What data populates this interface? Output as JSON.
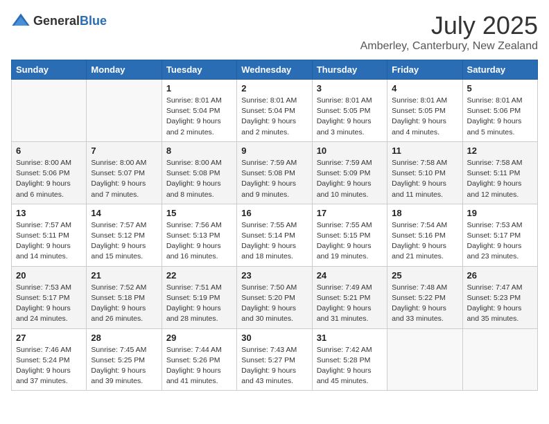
{
  "header": {
    "logo_general": "General",
    "logo_blue": "Blue",
    "month": "July 2025",
    "location": "Amberley, Canterbury, New Zealand"
  },
  "weekdays": [
    "Sunday",
    "Monday",
    "Tuesday",
    "Wednesday",
    "Thursday",
    "Friday",
    "Saturday"
  ],
  "weeks": [
    [
      {
        "day": "",
        "empty": true
      },
      {
        "day": "",
        "empty": true
      },
      {
        "day": "1",
        "sunrise": "Sunrise: 8:01 AM",
        "sunset": "Sunset: 5:04 PM",
        "daylight": "Daylight: 9 hours and 2 minutes."
      },
      {
        "day": "2",
        "sunrise": "Sunrise: 8:01 AM",
        "sunset": "Sunset: 5:04 PM",
        "daylight": "Daylight: 9 hours and 2 minutes."
      },
      {
        "day": "3",
        "sunrise": "Sunrise: 8:01 AM",
        "sunset": "Sunset: 5:05 PM",
        "daylight": "Daylight: 9 hours and 3 minutes."
      },
      {
        "day": "4",
        "sunrise": "Sunrise: 8:01 AM",
        "sunset": "Sunset: 5:05 PM",
        "daylight": "Daylight: 9 hours and 4 minutes."
      },
      {
        "day": "5",
        "sunrise": "Sunrise: 8:01 AM",
        "sunset": "Sunset: 5:06 PM",
        "daylight": "Daylight: 9 hours and 5 minutes."
      }
    ],
    [
      {
        "day": "6",
        "sunrise": "Sunrise: 8:00 AM",
        "sunset": "Sunset: 5:06 PM",
        "daylight": "Daylight: 9 hours and 6 minutes."
      },
      {
        "day": "7",
        "sunrise": "Sunrise: 8:00 AM",
        "sunset": "Sunset: 5:07 PM",
        "daylight": "Daylight: 9 hours and 7 minutes."
      },
      {
        "day": "8",
        "sunrise": "Sunrise: 8:00 AM",
        "sunset": "Sunset: 5:08 PM",
        "daylight": "Daylight: 9 hours and 8 minutes."
      },
      {
        "day": "9",
        "sunrise": "Sunrise: 7:59 AM",
        "sunset": "Sunset: 5:08 PM",
        "daylight": "Daylight: 9 hours and 9 minutes."
      },
      {
        "day": "10",
        "sunrise": "Sunrise: 7:59 AM",
        "sunset": "Sunset: 5:09 PM",
        "daylight": "Daylight: 9 hours and 10 minutes."
      },
      {
        "day": "11",
        "sunrise": "Sunrise: 7:58 AM",
        "sunset": "Sunset: 5:10 PM",
        "daylight": "Daylight: 9 hours and 11 minutes."
      },
      {
        "day": "12",
        "sunrise": "Sunrise: 7:58 AM",
        "sunset": "Sunset: 5:11 PM",
        "daylight": "Daylight: 9 hours and 12 minutes."
      }
    ],
    [
      {
        "day": "13",
        "sunrise": "Sunrise: 7:57 AM",
        "sunset": "Sunset: 5:11 PM",
        "daylight": "Daylight: 9 hours and 14 minutes."
      },
      {
        "day": "14",
        "sunrise": "Sunrise: 7:57 AM",
        "sunset": "Sunset: 5:12 PM",
        "daylight": "Daylight: 9 hours and 15 minutes."
      },
      {
        "day": "15",
        "sunrise": "Sunrise: 7:56 AM",
        "sunset": "Sunset: 5:13 PM",
        "daylight": "Daylight: 9 hours and 16 minutes."
      },
      {
        "day": "16",
        "sunrise": "Sunrise: 7:55 AM",
        "sunset": "Sunset: 5:14 PM",
        "daylight": "Daylight: 9 hours and 18 minutes."
      },
      {
        "day": "17",
        "sunrise": "Sunrise: 7:55 AM",
        "sunset": "Sunset: 5:15 PM",
        "daylight": "Daylight: 9 hours and 19 minutes."
      },
      {
        "day": "18",
        "sunrise": "Sunrise: 7:54 AM",
        "sunset": "Sunset: 5:16 PM",
        "daylight": "Daylight: 9 hours and 21 minutes."
      },
      {
        "day": "19",
        "sunrise": "Sunrise: 7:53 AM",
        "sunset": "Sunset: 5:17 PM",
        "daylight": "Daylight: 9 hours and 23 minutes."
      }
    ],
    [
      {
        "day": "20",
        "sunrise": "Sunrise: 7:53 AM",
        "sunset": "Sunset: 5:17 PM",
        "daylight": "Daylight: 9 hours and 24 minutes."
      },
      {
        "day": "21",
        "sunrise": "Sunrise: 7:52 AM",
        "sunset": "Sunset: 5:18 PM",
        "daylight": "Daylight: 9 hours and 26 minutes."
      },
      {
        "day": "22",
        "sunrise": "Sunrise: 7:51 AM",
        "sunset": "Sunset: 5:19 PM",
        "daylight": "Daylight: 9 hours and 28 minutes."
      },
      {
        "day": "23",
        "sunrise": "Sunrise: 7:50 AM",
        "sunset": "Sunset: 5:20 PM",
        "daylight": "Daylight: 9 hours and 30 minutes."
      },
      {
        "day": "24",
        "sunrise": "Sunrise: 7:49 AM",
        "sunset": "Sunset: 5:21 PM",
        "daylight": "Daylight: 9 hours and 31 minutes."
      },
      {
        "day": "25",
        "sunrise": "Sunrise: 7:48 AM",
        "sunset": "Sunset: 5:22 PM",
        "daylight": "Daylight: 9 hours and 33 minutes."
      },
      {
        "day": "26",
        "sunrise": "Sunrise: 7:47 AM",
        "sunset": "Sunset: 5:23 PM",
        "daylight": "Daylight: 9 hours and 35 minutes."
      }
    ],
    [
      {
        "day": "27",
        "sunrise": "Sunrise: 7:46 AM",
        "sunset": "Sunset: 5:24 PM",
        "daylight": "Daylight: 9 hours and 37 minutes."
      },
      {
        "day": "28",
        "sunrise": "Sunrise: 7:45 AM",
        "sunset": "Sunset: 5:25 PM",
        "daylight": "Daylight: 9 hours and 39 minutes."
      },
      {
        "day": "29",
        "sunrise": "Sunrise: 7:44 AM",
        "sunset": "Sunset: 5:26 PM",
        "daylight": "Daylight: 9 hours and 41 minutes."
      },
      {
        "day": "30",
        "sunrise": "Sunrise: 7:43 AM",
        "sunset": "Sunset: 5:27 PM",
        "daylight": "Daylight: 9 hours and 43 minutes."
      },
      {
        "day": "31",
        "sunrise": "Sunrise: 7:42 AM",
        "sunset": "Sunset: 5:28 PM",
        "daylight": "Daylight: 9 hours and 45 minutes."
      },
      {
        "day": "",
        "empty": true
      },
      {
        "day": "",
        "empty": true
      }
    ]
  ]
}
